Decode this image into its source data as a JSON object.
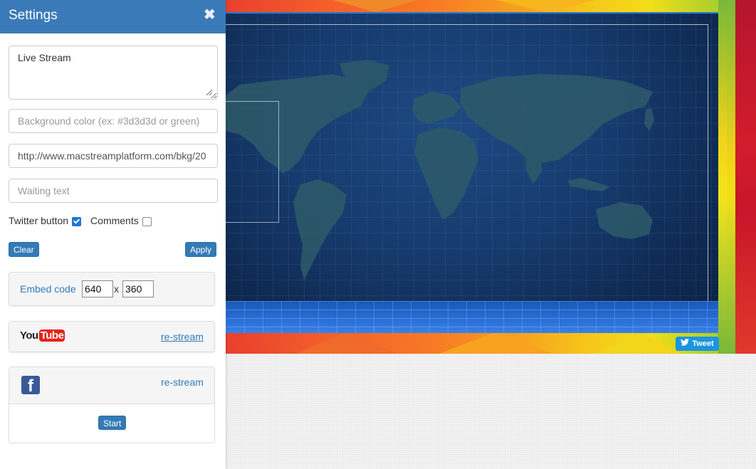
{
  "settings": {
    "title": "Settings",
    "title_textarea_value": "Live Stream",
    "bg_color_placeholder": "Background color (ex: #3d3d3d or green)",
    "bg_image_value": "http://www.macstreamplatform.com/bkg/20",
    "waiting_text_placeholder": "Waiting text",
    "twitter_button_label": "Twitter button",
    "twitter_button_checked": true,
    "comments_label": "Comments",
    "comments_checked": false,
    "clear_label": "Clear",
    "apply_label": "Apply",
    "embed_code_label": "Embed code",
    "embed_width": "640",
    "embed_height": "360",
    "embed_separator": "x",
    "youtube_logo_you": "You",
    "youtube_logo_tube": "Tube",
    "youtube_restream_label": "re-stream",
    "facebook_restream_label": "re-stream",
    "start_label": "Start"
  },
  "stage": {
    "tweet_label": "Tweet"
  },
  "colors": {
    "header": "#3a7ab8",
    "primary_button": "#337ab7",
    "tweet": "#1b95e0",
    "youtube_red": "#e62117",
    "facebook_blue": "#3b5998"
  },
  "icons": {
    "close": "close-icon",
    "twitter": "twitter-bird-icon",
    "youtube": "youtube-logo",
    "facebook": "facebook-logo"
  }
}
